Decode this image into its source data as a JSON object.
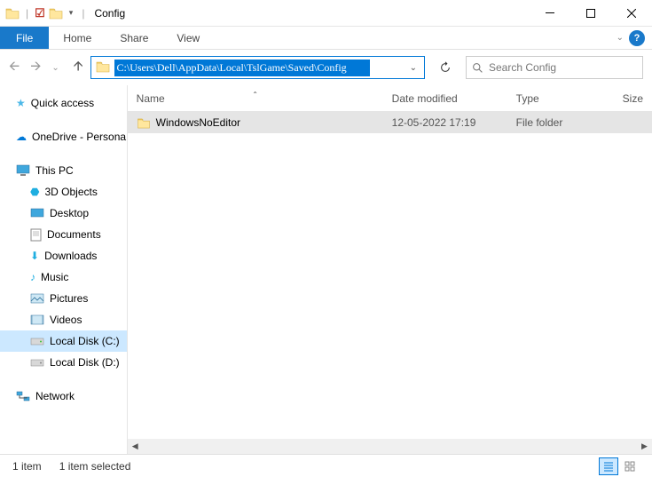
{
  "window": {
    "title": "Config"
  },
  "ribbon": {
    "file": "File",
    "tabs": [
      "Home",
      "Share",
      "View"
    ]
  },
  "navigation": {
    "path": "C:\\Users\\Dell\\AppData\\Local\\TslGame\\Saved\\Config"
  },
  "search": {
    "placeholder": "Search Config"
  },
  "sidebar": {
    "quick_access": "Quick access",
    "onedrive": "OneDrive - Persona",
    "this_pc": "This PC",
    "items": [
      "3D Objects",
      "Desktop",
      "Documents",
      "Downloads",
      "Music",
      "Pictures",
      "Videos",
      "Local Disk (C:)",
      "Local Disk (D:)"
    ],
    "network": "Network"
  },
  "columns": {
    "name": "Name",
    "date": "Date modified",
    "type": "Type",
    "size": "Size"
  },
  "files": [
    {
      "name": "WindowsNoEditor",
      "date": "12-05-2022 17:19",
      "type": "File folder"
    }
  ],
  "status": {
    "count": "1 item",
    "selected": "1 item selected"
  }
}
